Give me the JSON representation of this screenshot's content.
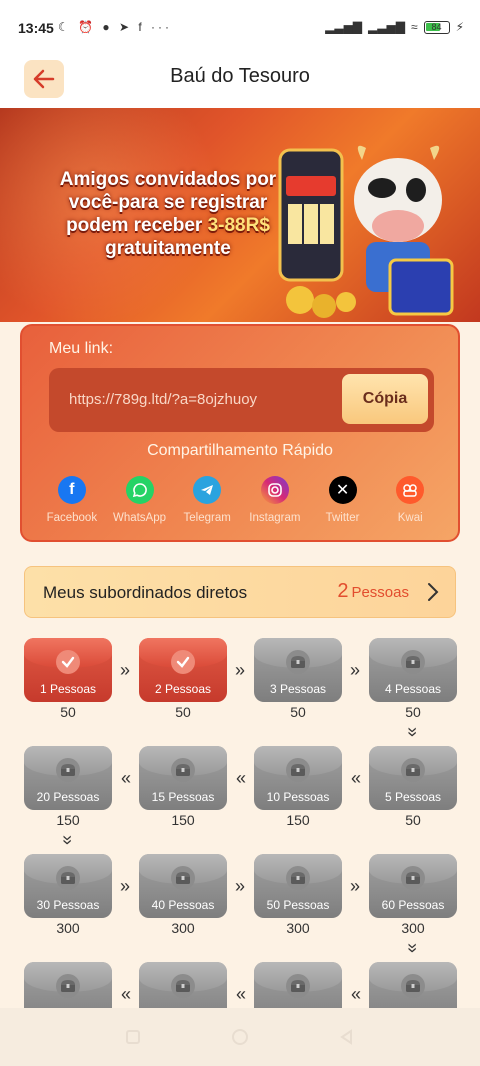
{
  "status_bar": {
    "time": "13:45",
    "battery": "84"
  },
  "header": {
    "title": "Baú do Tesouro"
  },
  "banner": {
    "line1": "Amigos convidados por",
    "line2": "você-para se registrar",
    "line3_pre": "podem receber ",
    "line3_highlight": "3-88R$",
    "line4": "gratuitamente"
  },
  "link_card": {
    "label": "Meu link:",
    "url": "https://789g.ltd/?a=8ojzhuoy",
    "copy_label": "Cópia",
    "share_title": "Compartilhamento Rápido",
    "share_items": [
      {
        "label": "Facebook",
        "icon": "facebook-icon",
        "color": "#1877f2"
      },
      {
        "label": "WhatsApp",
        "icon": "whatsapp-icon",
        "color": "#25d366"
      },
      {
        "label": "Telegram",
        "icon": "telegram-icon",
        "color": "#2aa3df"
      },
      {
        "label": "Instagram",
        "icon": "instagram-icon",
        "color": "#d62976"
      },
      {
        "label": "Twitter",
        "icon": "x-icon",
        "color": "#000000"
      },
      {
        "label": "Kwai",
        "icon": "kwai-icon",
        "color": "#ff5a2c"
      }
    ]
  },
  "subordinates": {
    "label": "Meus subordinados diretos",
    "count": "2",
    "unit": "Pessoas"
  },
  "tiers": [
    {
      "label": "1 Pessoas",
      "reward": "50",
      "done": true
    },
    {
      "label": "2 Pessoas",
      "reward": "50",
      "done": true
    },
    {
      "label": "3 Pessoas",
      "reward": "50",
      "done": false
    },
    {
      "label": "4 Pessoas",
      "reward": "50",
      "done": false
    },
    {
      "label": "5 Pessoas",
      "reward": "50",
      "done": false
    },
    {
      "label": "10 Pessoas",
      "reward": "150",
      "done": false
    },
    {
      "label": "15 Pessoas",
      "reward": "150",
      "done": false
    },
    {
      "label": "20 Pessoas",
      "reward": "150",
      "done": false
    },
    {
      "label": "30 Pessoas",
      "reward": "300",
      "done": false
    },
    {
      "label": "40 Pessoas",
      "reward": "300",
      "done": false
    },
    {
      "label": "50 Pessoas",
      "reward": "300",
      "done": false
    },
    {
      "label": "60 Pessoas",
      "reward": "300",
      "done": false
    },
    {
      "label": "",
      "reward": "",
      "done": false
    },
    {
      "label": "",
      "reward": "",
      "done": false
    },
    {
      "label": "",
      "reward": "",
      "done": false
    },
    {
      "label": "",
      "reward": "",
      "done": false
    }
  ],
  "colors": {
    "accent": "#e24d2e",
    "done": "#d34634",
    "locked": "#8c8c8c"
  }
}
